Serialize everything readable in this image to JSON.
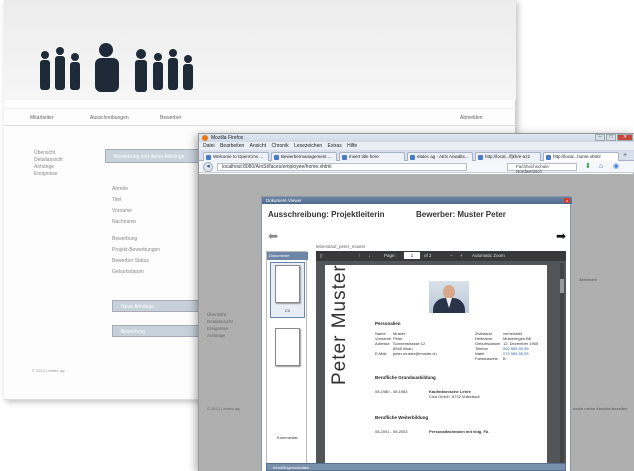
{
  "background_app": {
    "nav": [
      "Mitarbeiter",
      "Ausschreibungen",
      "Bewerber",
      "Abmelden"
    ],
    "sidebar": [
      "Übersicht",
      "Detailansicht",
      "Anhänge",
      "Ereignisse"
    ],
    "form_header": "Bewerbung und deren Anhänge",
    "fields": [
      "Anrede",
      "Titel",
      "Vorname",
      "Nachname",
      "Bewerbung",
      "Projekt-Bewerbungen",
      "Bewerber Status",
      "Geburtsdatum"
    ],
    "buttons": [
      "Neue Anhänge",
      "Bewertung"
    ],
    "footer": "© 2012 | elatec ag"
  },
  "firefox": {
    "title": "Mozilla Firefox",
    "menu": [
      "Datei",
      "Bearbeiten",
      "Ansicht",
      "Chronik",
      "Lesezeichen",
      "Extras",
      "Hilfe"
    ],
    "tabs": [
      "Welcome to OpenCms ...",
      "Bewerbermanagement ...",
      "Insert title here",
      "elatec ag - AES Anwalts...",
      "http://local...ffjkh/e-az2",
      "http://local...home.xhtml"
    ],
    "url": "localhost:8080/AmSt/faces/employee/home.xhtml",
    "search_placeholder": "Fachhochschule Nordwestsch",
    "win_buttons": [
      "–",
      "□",
      "✕"
    ]
  },
  "page": {
    "sidebar": [
      "Übersicht",
      "Detailansicht",
      "Ereignisse",
      "Anhänge"
    ],
    "footer": "© 2012 | elatec ag",
    "right_nav": "Abmelden",
    "right_text": "sowie meine Abschiedesseiten"
  },
  "modal": {
    "title": "Dokument-Viewer",
    "close": "x",
    "ausschreibung": "Ausschreibung: Projektleiterin",
    "bewerber": "Bewerber: Muster Peter",
    "attachment_name": "lebenslauf_peter_muster",
    "thumb_header": "Dokumente",
    "thumb_labels": [
      "CV",
      "Kommentar"
    ],
    "pdf_toolbar": {
      "page_label": "Page:",
      "page_value": "1",
      "page_total": "of 2",
      "zoom": "Automatic Zoom"
    },
    "footer_label": "Inhalt/Eigenschaften"
  },
  "cv": {
    "vertical_name": "Peter Muster",
    "section_personal": "Personalien",
    "personal_left": [
      [
        "Name",
        "Muster"
      ],
      [
        "Vorname",
        "Peter"
      ],
      [
        "Adresse",
        "Sonnenstrasse 12"
      ],
      [
        "",
        "8546 Illnau"
      ],
      [
        "E-Mail",
        "peter.muster@muster.ch"
      ]
    ],
    "personal_right": [
      [
        "Zivilstand",
        "verheiratet"
      ],
      [
        "Heimatort",
        "Musteringen BE"
      ],
      [
        "Geburtsdatum",
        "12. Dezember 1965"
      ],
      [
        "Telefon",
        "052 555 55 55"
      ],
      [
        "Natel",
        "079 555 55 55"
      ],
      [
        "Fahrausweis",
        "B"
      ]
    ],
    "section_basic": "Berufliche Grundausbildung",
    "basic_row": [
      "08.1980 - 08.1983",
      "Kaufmännische Lehre",
      "Cica GmbH, 8732 Volketswil"
    ],
    "section_further": "Berufliche Weiterbildung",
    "further_row": [
      "08.2001 - 06.2003",
      "Personalfachmann mit eidg. FA"
    ]
  },
  "colors": {
    "accent": "#6d86a6",
    "close": "#d23c2e",
    "pdf_bg": "#525659"
  }
}
